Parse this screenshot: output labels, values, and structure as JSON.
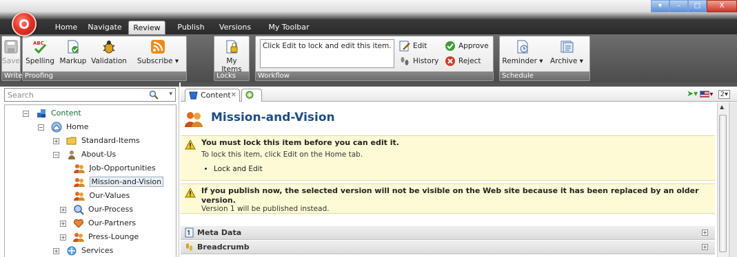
{
  "window": {
    "menu_tabs": [
      "Home",
      "Navigate",
      "Review",
      "Publish",
      "Versions",
      "My Toolbar"
    ],
    "active_tab": "Review",
    "controls": {
      "minimize": "▾",
      "restore": "–",
      "maximize": "□",
      "close": "X"
    }
  },
  "ribbon": {
    "write": {
      "label": "Write",
      "save": "Save"
    },
    "proofing": {
      "label": "Proofing",
      "spelling": "Spelling",
      "markup": "Markup",
      "validation": "Validation",
      "subscribe": "Subscribe"
    },
    "locks": {
      "label": "Locks",
      "my_items_line1": "My Items",
      "my_items_line2": ""
    },
    "workflow": {
      "label": "Workflow",
      "message": "Click Edit to lock and edit this item.",
      "edit": "Edit",
      "history": "History",
      "approve": "Approve",
      "reject": "Reject"
    },
    "schedule": {
      "label": "Schedule",
      "reminder": "Reminder",
      "archive": "Archive"
    }
  },
  "search": {
    "placeholder": "Search"
  },
  "tree": {
    "items": [
      {
        "label": "Content"
      },
      {
        "label": "Home"
      },
      {
        "label": "Standard-Items"
      },
      {
        "label": "About-Us"
      },
      {
        "label": "Job-Opportunities"
      },
      {
        "label": "Mission-and-Vision"
      },
      {
        "label": "Our-Values"
      },
      {
        "label": "Our-Process"
      },
      {
        "label": "Our-Partners"
      },
      {
        "label": "Press-Lounge"
      },
      {
        "label": "Services"
      }
    ]
  },
  "editor": {
    "tab_content": "Content",
    "language_number": "2",
    "item_title": "Mission-and-Vision",
    "warning1": {
      "title": "You must lock this item before you can edit it.",
      "sub": "To lock this item, click Edit on the Home tab.",
      "bullet": "Lock and Edit"
    },
    "warning2": {
      "title": "If you publish now, the selected version will not be visible on the Web site because it has been replaced by an older version.",
      "sub": "Version 1 will be published instead."
    },
    "sections": [
      "Meta Data",
      "Breadcrumb"
    ]
  }
}
